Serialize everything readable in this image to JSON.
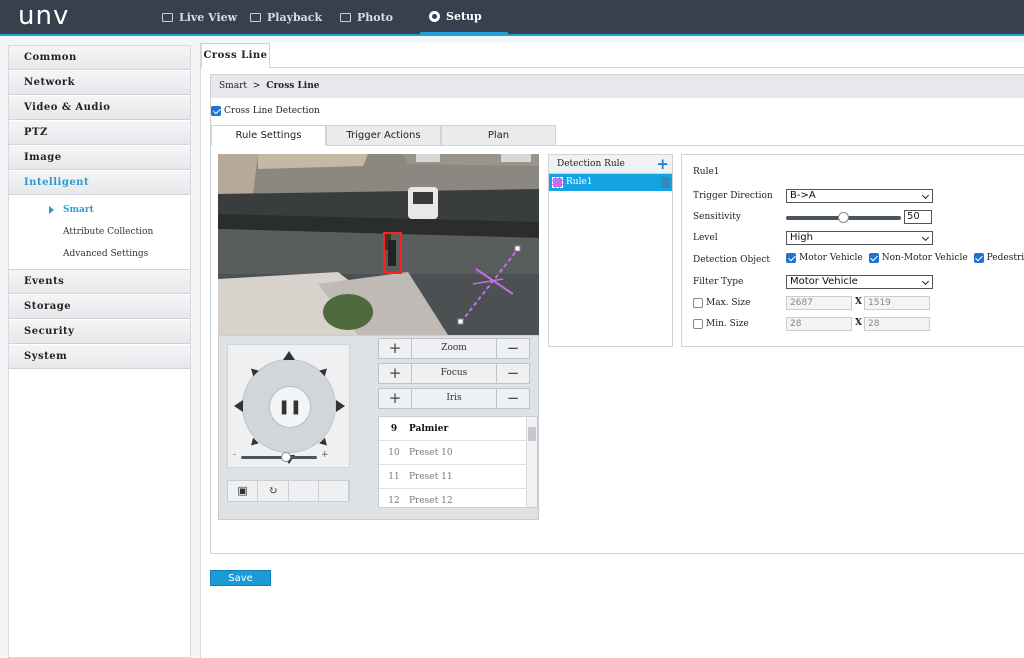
{
  "app": {
    "logo": "unv"
  },
  "topnav": [
    {
      "label": "Live View",
      "icon": "monitor-icon"
    },
    {
      "label": "Playback",
      "icon": "film-icon"
    },
    {
      "label": "Photo",
      "icon": "photo-icon"
    },
    {
      "label": "Setup",
      "icon": "gear-icon"
    }
  ],
  "sidebar": {
    "items": [
      "Common",
      "Network",
      "Video & Audio",
      "PTZ",
      "Image",
      "Intelligent",
      "Events",
      "Storage",
      "Security",
      "System"
    ],
    "active": "Intelligent",
    "sub_items": [
      "Smart",
      "Attribute Collection",
      "Advanced Settings"
    ],
    "active_sub": "Smart"
  },
  "main": {
    "tab": "Cross Line",
    "breadcrumb": {
      "parent": "Smart",
      "sep": ">",
      "current": "Cross Line"
    },
    "enable_label": "Cross Line Detection",
    "enable_checked": true,
    "tabs": [
      "Rule Settings",
      "Trigger Actions",
      "Plan"
    ],
    "active_tab": "Rule Settings"
  },
  "ptz": {
    "slider_min": "-",
    "slider_max": "+",
    "zoom_label": "Zoom",
    "focus_label": "Focus",
    "iris_label": "Iris",
    "presets": [
      {
        "num": "9",
        "name": "Palmier"
      },
      {
        "num": "10",
        "name": "Preset 10"
      },
      {
        "num": "11",
        "name": "Preset 11"
      },
      {
        "num": "12",
        "name": "Preset 12"
      }
    ]
  },
  "rules": {
    "header": "Detection Rule",
    "items": [
      "Rule1"
    ]
  },
  "props": {
    "title": "Rule1",
    "trigger_direction_label": "Trigger Direction",
    "trigger_direction": "B->A",
    "sensitivity_label": "Sensitivity",
    "sensitivity": "50",
    "sensitivity_fraction": 0.5,
    "level_label": "Level",
    "level": "High",
    "detection_object_label": "Detection Object",
    "objects": [
      "Motor Vehicle",
      "Non-Motor Vehicle",
      "Pedestrian"
    ],
    "filter_type_label": "Filter Type",
    "filter_type": "Motor Vehicle",
    "max_size_label": "Max. Size",
    "max_w": "2687",
    "max_h": "1519",
    "min_size_label": "Min. Size",
    "min_w": "28",
    "min_h": "28",
    "x_label": "X"
  },
  "actions": {
    "save": "Save"
  },
  "colors": {
    "accent": "#23a0d6",
    "topbar": "#37414d",
    "rule_selected": "#15a4e3",
    "rule_swatch": "#c070e8"
  }
}
